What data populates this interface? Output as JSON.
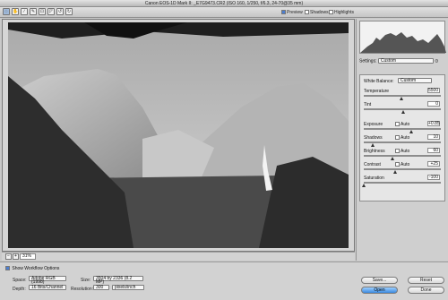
{
  "window": {
    "title": "Canon EOS-1D Mark II: _E7G9473.CR2 (ISO 160, 1/250, f/6.3, 24-70@35 mm)"
  },
  "toolbar": {
    "tools": [
      "zoom-tool",
      "hand-tool",
      "white-balance-tool",
      "color-sampler-tool",
      "crop-tool",
      "straighten-tool",
      "rotate-left-tool",
      "rotate-right-tool"
    ],
    "preview_label": "Preview",
    "shadows_label": "Shadows",
    "highlights_label": "Highlights",
    "preview_checked": true
  },
  "zoom": {
    "value": "31%"
  },
  "settings": {
    "label": "Settings:",
    "value": "Custom"
  },
  "tabs": [
    "Adjust",
    "Detail",
    "Lens",
    "Curve",
    "Calibrate"
  ],
  "adjust": {
    "white_balance_label": "White Balance:",
    "white_balance_value": "Custom",
    "temperature_label": "Temperature",
    "temperature_value": "5500",
    "tint_label": "Tint",
    "tint_value": "0",
    "exposure_label": "Exposure",
    "exposure_value": "+0.85",
    "shadows_label": "Shadows",
    "shadows_value": "10",
    "brightness_label": "Brightness",
    "brightness_value": "60",
    "contrast_label": "Contrast",
    "contrast_value": "+25",
    "saturation_label": "Saturation",
    "saturation_value": "-100",
    "auto_label": "Auto"
  },
  "workflow": {
    "show_label": "Show Workflow Options",
    "space_label": "Space:",
    "space_value": "Adobe RGB (1998)",
    "depth_label": "Depth:",
    "depth_value": "16 Bits/Channel",
    "size_label": "Size:",
    "size_value": "3504 by 2336 (8.2 MP)",
    "resolution_label": "Resolution:",
    "resolution_value": "300",
    "resolution_unit": "pixels/inch"
  },
  "buttons": {
    "save": "Save...",
    "reset": "Reset",
    "open": "Open",
    "done": "Done"
  },
  "colors": {
    "accent": "#3a89df",
    "panel": "#cfcfcf"
  }
}
